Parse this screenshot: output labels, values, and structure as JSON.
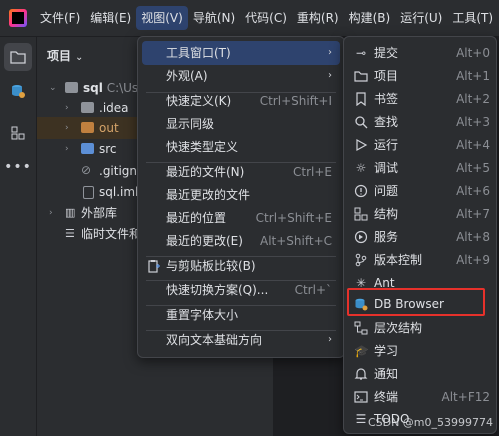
{
  "menubar": {
    "items": [
      "文件(F)",
      "编辑(E)",
      "视图(V)",
      "导航(N)",
      "代码(C)",
      "重构(R)",
      "构建(B)",
      "运行(U)",
      "工具(T)"
    ],
    "active_index": 2
  },
  "project": {
    "title": "项目",
    "tree": [
      {
        "label": "sql",
        "path": "C:\\Use",
        "icon": "module-folder-icon"
      },
      {
        "label": ".idea",
        "icon": "folder-icon"
      },
      {
        "label": "out",
        "icon": "excluded-folder-icon"
      },
      {
        "label": "src",
        "icon": "source-folder-icon"
      },
      {
        "label": ".gitignc",
        "icon": "ignore-file-icon"
      },
      {
        "label": "sql.iml",
        "icon": "iml-file-icon"
      },
      {
        "label": "外部库",
        "icon": "library-icon"
      },
      {
        "label": "临时文件和",
        "icon": "scratch-icon"
      }
    ]
  },
  "view_menu": {
    "items": [
      {
        "label": "工具窗口(T)",
        "submenu": true
      },
      {
        "label": "外观(A)",
        "submenu": true
      },
      {
        "label": "快速定义(K)",
        "shortcut": "Ctrl+Shift+I"
      },
      {
        "label": "显示同级",
        "shortcut": ""
      },
      {
        "label": "快速类型定义",
        "shortcut": ""
      },
      {
        "label": "最近的文件(N)",
        "shortcut": "Ctrl+E"
      },
      {
        "label": "最近更改的文件",
        "shortcut": ""
      },
      {
        "label": "最近的位置",
        "shortcut": "Ctrl+Shift+E"
      },
      {
        "label": "最近的更改(E)",
        "shortcut": "Alt+Shift+C"
      },
      {
        "label": "与剪贴板比较(B)",
        "shortcut": "",
        "icon": "clipboard-compare-icon"
      },
      {
        "label": "快速切换方案(Q)...",
        "shortcut": "Ctrl+`"
      },
      {
        "label": "重置字体大小",
        "shortcut": ""
      },
      {
        "label": "双向文本基础方向",
        "submenu": true
      }
    ]
  },
  "tool_windows_menu": {
    "items": [
      {
        "label": "提交",
        "shortcut": "Alt+0",
        "icon": "commit-icon"
      },
      {
        "label": "项目",
        "shortcut": "Alt+1",
        "icon": "folder-icon"
      },
      {
        "label": "书签",
        "shortcut": "Alt+2",
        "icon": "bookmark-icon"
      },
      {
        "label": "查找",
        "shortcut": "Alt+3",
        "icon": "search-icon"
      },
      {
        "label": "运行",
        "shortcut": "Alt+4",
        "icon": "run-icon"
      },
      {
        "label": "调试",
        "shortcut": "Alt+5",
        "icon": "bug-icon"
      },
      {
        "label": "问题",
        "shortcut": "Alt+6",
        "icon": "problems-icon"
      },
      {
        "label": "结构",
        "shortcut": "Alt+7",
        "icon": "structure-icon"
      },
      {
        "label": "服务",
        "shortcut": "Alt+8",
        "icon": "services-icon"
      },
      {
        "label": "版本控制",
        "shortcut": "Alt+9",
        "icon": "vcs-icon"
      },
      {
        "label": "Ant",
        "shortcut": "",
        "icon": "ant-icon"
      },
      {
        "label": "DB Browser",
        "shortcut": "",
        "icon": "database-icon"
      },
      {
        "label": "层次结构",
        "shortcut": "",
        "icon": "hierarchy-icon"
      },
      {
        "label": "学习",
        "shortcut": "",
        "icon": "learn-icon"
      },
      {
        "label": "通知",
        "shortcut": "",
        "icon": "bell-icon"
      },
      {
        "label": "终端",
        "shortcut": "Alt+F12",
        "icon": "terminal-icon"
      },
      {
        "label": "TODO",
        "shortcut": "",
        "icon": "todo-icon"
      }
    ]
  },
  "watermark": "CSDN @m0_53999774",
  "colors": {
    "highlight_border": "#e6312b",
    "active_menu": "#2e436e"
  }
}
